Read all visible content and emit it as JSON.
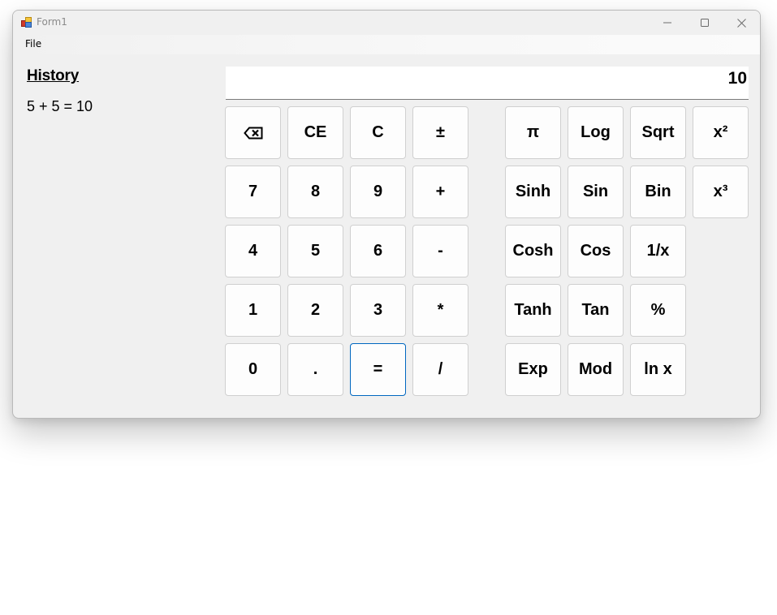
{
  "window": {
    "title": "Form1",
    "app_icon": "winforms-app-icon",
    "controls": {
      "minimize": "minimize-icon",
      "maximize": "maximize-icon",
      "close": "close-icon"
    }
  },
  "menu": {
    "items": [
      {
        "label": "File"
      }
    ]
  },
  "history": {
    "title": "History",
    "entries": [
      "5 + 5 = 10"
    ]
  },
  "display": {
    "value": "10"
  },
  "buttons": {
    "basic": [
      [
        {
          "id": "backspace",
          "label": "",
          "icon": "backspace-icon"
        },
        {
          "id": "clear-entry",
          "label": "CE"
        },
        {
          "id": "clear",
          "label": "C"
        },
        {
          "id": "negate",
          "label": "±"
        }
      ],
      [
        {
          "id": "digit-7",
          "label": "7"
        },
        {
          "id": "digit-8",
          "label": "8"
        },
        {
          "id": "digit-9",
          "label": "9"
        },
        {
          "id": "add",
          "label": "+"
        }
      ],
      [
        {
          "id": "digit-4",
          "label": "4"
        },
        {
          "id": "digit-5",
          "label": "5"
        },
        {
          "id": "digit-6",
          "label": "6"
        },
        {
          "id": "subtract",
          "label": "-"
        }
      ],
      [
        {
          "id": "digit-1",
          "label": "1"
        },
        {
          "id": "digit-2",
          "label": "2"
        },
        {
          "id": "digit-3",
          "label": "3"
        },
        {
          "id": "multiply",
          "label": "*"
        }
      ],
      [
        {
          "id": "digit-0",
          "label": "0"
        },
        {
          "id": "decimal",
          "label": "."
        },
        {
          "id": "equals",
          "label": "=",
          "focused": true
        },
        {
          "id": "divide",
          "label": "/"
        }
      ]
    ],
    "scientific": [
      [
        {
          "id": "pi",
          "label": "π"
        },
        {
          "id": "log",
          "label": "Log"
        },
        {
          "id": "sqrt",
          "label": "Sqrt"
        },
        {
          "id": "square",
          "label": "x²"
        }
      ],
      [
        {
          "id": "sinh",
          "label": "Sinh"
        },
        {
          "id": "sin",
          "label": "Sin"
        },
        {
          "id": "bin",
          "label": "Bin"
        },
        {
          "id": "cube",
          "label": "x³"
        }
      ],
      [
        {
          "id": "cosh",
          "label": "Cosh"
        },
        {
          "id": "cos",
          "label": "Cos"
        },
        {
          "id": "reciprocal",
          "label": "1/x"
        }
      ],
      [
        {
          "id": "tanh",
          "label": "Tanh"
        },
        {
          "id": "tan",
          "label": "Tan"
        },
        {
          "id": "percent",
          "label": "%"
        }
      ],
      [
        {
          "id": "exp",
          "label": "Exp"
        },
        {
          "id": "mod",
          "label": "Mod"
        },
        {
          "id": "ln",
          "label": "ln x"
        }
      ]
    ]
  },
  "colors": {
    "focus_border": "#0067c0",
    "window_bg": "#f0f0f0",
    "button_bg": "#fdfdfd"
  }
}
